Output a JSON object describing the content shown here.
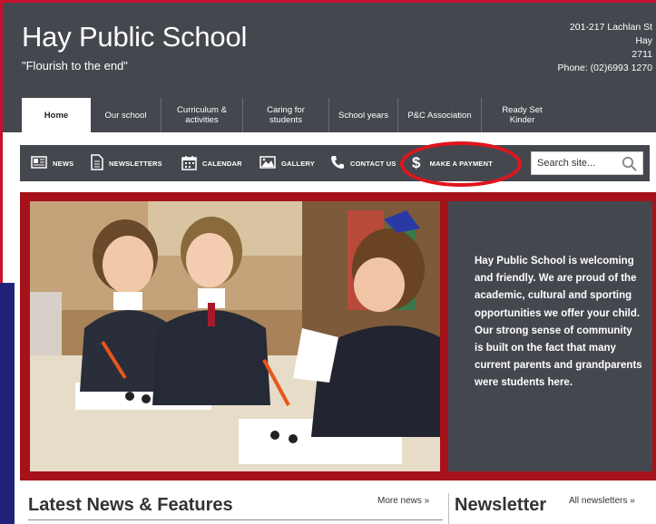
{
  "header": {
    "title": "Hay Public School",
    "tagline": "\"Flourish to the end\"",
    "address_street": "201-217 Lachlan St",
    "address_town": "Hay",
    "address_postcode": "2711",
    "phone": "Phone: (02)6993 1270"
  },
  "tabs": [
    {
      "label": "Home",
      "active": true
    },
    {
      "label": "Our school"
    },
    {
      "label": "Curriculum & activities"
    },
    {
      "label": "Caring for students"
    },
    {
      "label": "School years"
    },
    {
      "label": "P&C Association"
    },
    {
      "label": "Ready Set Kinder"
    }
  ],
  "toolbar": {
    "news": "NEWS",
    "newsletters": "NEWSLETTERS",
    "calendar": "CALENDAR",
    "gallery": "GALLERY",
    "contact": "CONTACT US",
    "payment": "MAKE A PAYMENT"
  },
  "search": {
    "placeholder": "Search site..."
  },
  "hero": {
    "text": "Hay Public School is welcoming and friendly. We are proud of the academic, cultural and sporting opportunities we offer your child. Our strong sense of community is built on the fact that many current parents and grandparents were students here."
  },
  "sections": {
    "news_title": "Latest News & Features",
    "more_news": "More news »",
    "newsletter_title": "Newsletter",
    "all_newsletters": "All newsletters »"
  },
  "colors": {
    "header_bg": "#45474e",
    "accent_red": "#c8102e",
    "hero_border": "#a5121a",
    "highlight_ring": "#e1141c"
  }
}
